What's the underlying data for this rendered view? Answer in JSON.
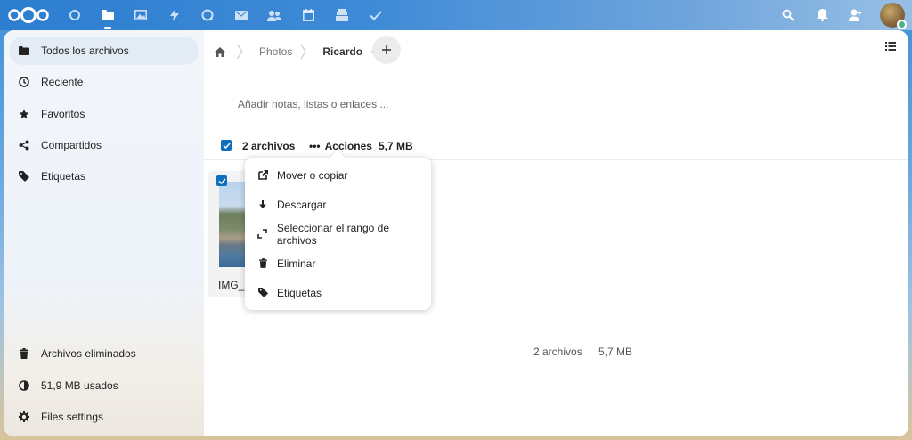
{
  "header": {
    "apps": [
      {
        "name": "dashboard-icon"
      },
      {
        "name": "files-icon",
        "active": true
      },
      {
        "name": "photos-icon"
      },
      {
        "name": "activity-icon"
      },
      {
        "name": "talk-icon"
      },
      {
        "name": "mail-icon"
      },
      {
        "name": "contacts-icon"
      },
      {
        "name": "calendar-icon"
      },
      {
        "name": "deck-icon"
      },
      {
        "name": "tasks-icon"
      }
    ],
    "right": [
      "search-icon",
      "notifications-icon",
      "contacts-menu-icon"
    ]
  },
  "sidebar": {
    "items": [
      {
        "label": "Todos los archivos",
        "icon": "folder-icon"
      },
      {
        "label": "Reciente",
        "icon": "clock-icon"
      },
      {
        "label": "Favoritos",
        "icon": "star-icon"
      },
      {
        "label": "Compartidos",
        "icon": "share-icon"
      },
      {
        "label": "Etiquetas",
        "icon": "tag-icon"
      }
    ],
    "bottom": [
      {
        "label": "Archivos eliminados",
        "icon": "trash-icon"
      },
      {
        "label": "51,9 MB usados",
        "icon": "quota-icon"
      },
      {
        "label": "Files settings",
        "icon": "gear-icon"
      }
    ]
  },
  "breadcrumb": {
    "items": [
      "Photos",
      "Ricardo"
    ]
  },
  "notes_placeholder": "Añadir notas, listas o enlaces ...",
  "selection": {
    "count": "2 archivos",
    "actions": "Acciones",
    "size": "5,7 MB"
  },
  "file": {
    "name": "IMG_2"
  },
  "menu": {
    "items": [
      {
        "label": "Mover o copiar",
        "icon": "move-copy-icon"
      },
      {
        "label": "Descargar",
        "icon": "download-icon"
      },
      {
        "label": "Seleccionar el rango de archivos",
        "icon": "select-range-icon"
      },
      {
        "label": "Eliminar",
        "icon": "trash-icon"
      },
      {
        "label": "Etiquetas",
        "icon": "tag-icon"
      }
    ]
  },
  "summary": {
    "count": "2 archivos",
    "size": "5,7 MB"
  }
}
